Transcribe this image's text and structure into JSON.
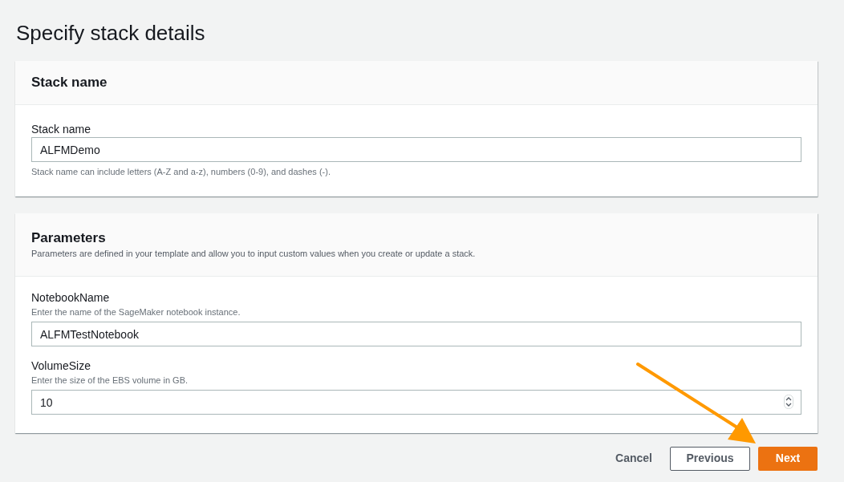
{
  "page_title": "Specify stack details",
  "stack_name_section": {
    "title": "Stack name",
    "field": {
      "label": "Stack name",
      "value": "ALFMDemo",
      "hint": "Stack name can include letters (A-Z and a-z), numbers (0-9), and dashes (-)."
    }
  },
  "parameters_section": {
    "title": "Parameters",
    "description": "Parameters are defined in your template and allow you to input custom values when you create or update a stack.",
    "fields": [
      {
        "kind": "text",
        "label": "NotebookName",
        "description": "Enter the name of the SageMaker notebook instance.",
        "value": "ALFMTestNotebook"
      },
      {
        "kind": "number",
        "label": "VolumeSize",
        "description": "Enter the size of the EBS volume in GB.",
        "value": "10"
      }
    ]
  },
  "actions": {
    "cancel": "Cancel",
    "previous": "Previous",
    "next": "Next"
  }
}
